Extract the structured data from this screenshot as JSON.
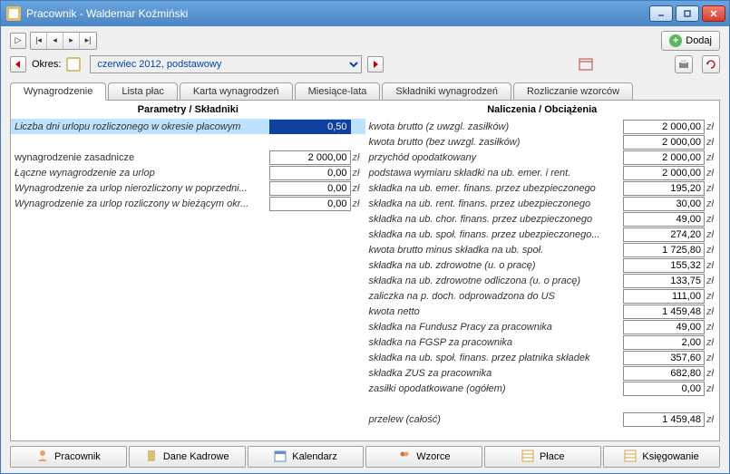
{
  "window_title": "Pracownik - Waldemar Koźmiński",
  "toolbar": {
    "add_label": "Dodaj",
    "okres_label": "Okres:",
    "period_value": "czerwiec 2012, podstawowy"
  },
  "tabs": [
    {
      "label": "Wynagrodzenie",
      "active": true
    },
    {
      "label": "Lista płac"
    },
    {
      "label": "Karta wynagrodzeń"
    },
    {
      "label": "Miesiące-lata"
    },
    {
      "label": "Składniki wynagrodzeń"
    },
    {
      "label": "Rozliczanie wzorców"
    }
  ],
  "left_header": "Parametry / Składniki",
  "right_header": "Naliczenia / Obciążenia",
  "left_rows": [
    {
      "label": "Liczba dni urlopu rozliczonego w okresie płacowym",
      "value": "0,50",
      "unit": "",
      "sel": true,
      "italic": true
    },
    {
      "label": "",
      "value": "",
      "unit": "",
      "spacer": true
    },
    {
      "label": "wynagrodzenie zasadnicze",
      "value": "2 000,00",
      "unit": "zł",
      "italic": false
    },
    {
      "label": "Łączne wynagrodzenie za urlop",
      "value": "0,00",
      "unit": "zł",
      "italic": true
    },
    {
      "label": "Wynagrodzenie za urlop nierozliczony w poprzedni...",
      "value": "0,00",
      "unit": "zł",
      "italic": true
    },
    {
      "label": "Wynagrodzenie za urlop rozliczony w bieżącym okr...",
      "value": "0,00",
      "unit": "zł",
      "italic": true
    }
  ],
  "right_rows": [
    {
      "label": "kwota brutto (z uwzgl. zasiłków)",
      "value": "2 000,00",
      "unit": "zł"
    },
    {
      "label": "kwota brutto (bez uwzgl. zasiłków)",
      "value": "2 000,00",
      "unit": "zł"
    },
    {
      "label": "przychód opodatkowany",
      "value": "2 000,00",
      "unit": "zł"
    },
    {
      "label": "podstawa wymiaru składki na ub. emer. i rent.",
      "value": "2 000,00",
      "unit": "zł"
    },
    {
      "label": "składka na ub. emer. finans. przez ubezpieczonego",
      "value": "195,20",
      "unit": "zł"
    },
    {
      "label": "składka na ub. rent. finans. przez ubezpieczonego",
      "value": "30,00",
      "unit": "zł"
    },
    {
      "label": "składka na ub. chor. finans. przez ubezpieczonego",
      "value": "49,00",
      "unit": "zł"
    },
    {
      "label": "składka na ub. społ. finans. przez ubezpieczonego...",
      "value": "274,20",
      "unit": "zł"
    },
    {
      "label": "kwota brutto minus składka na ub. społ.",
      "value": "1 725,80",
      "unit": "zł"
    },
    {
      "label": "składka na ub. zdrowotne (u. o pracę)",
      "value": "155,32",
      "unit": "zł"
    },
    {
      "label": "składka na ub. zdrowotne odliczona (u. o pracę)",
      "value": "133,75",
      "unit": "zł"
    },
    {
      "label": "zaliczka na p. doch. odprowadzona do US",
      "value": "111,00",
      "unit": "zł"
    },
    {
      "label": "kwota netto",
      "value": "1 459,48",
      "unit": "zł"
    },
    {
      "label": "składka na Fundusz Pracy za pracownika",
      "value": "49,00",
      "unit": "zł"
    },
    {
      "label": "składka na FGŚP za pracownika",
      "value": "2,00",
      "unit": "zł"
    },
    {
      "label": "składka na ub. społ. finans. przez płatnika składek",
      "value": "357,60",
      "unit": "zł"
    },
    {
      "label": "składka ZUS za pracownika",
      "value": "682,80",
      "unit": "zł"
    },
    {
      "label": "zasiłki opodatkowane (ogółem)",
      "value": "0,00",
      "unit": "zł"
    },
    {
      "label": "",
      "value": "",
      "unit": "",
      "spacer": true
    },
    {
      "label": "przelew (całość)",
      "value": "1 459,48",
      "unit": "zł"
    }
  ],
  "bottom_tabs": [
    {
      "label": "Pracownik",
      "icon": "user"
    },
    {
      "label": "Dane Kadrowe",
      "icon": "doc"
    },
    {
      "label": "Kalendarz",
      "icon": "cal"
    },
    {
      "label": "Wzorce",
      "icon": "users"
    },
    {
      "label": "Płace",
      "icon": "grid"
    },
    {
      "label": "Księgowanie",
      "icon": "grid"
    }
  ]
}
